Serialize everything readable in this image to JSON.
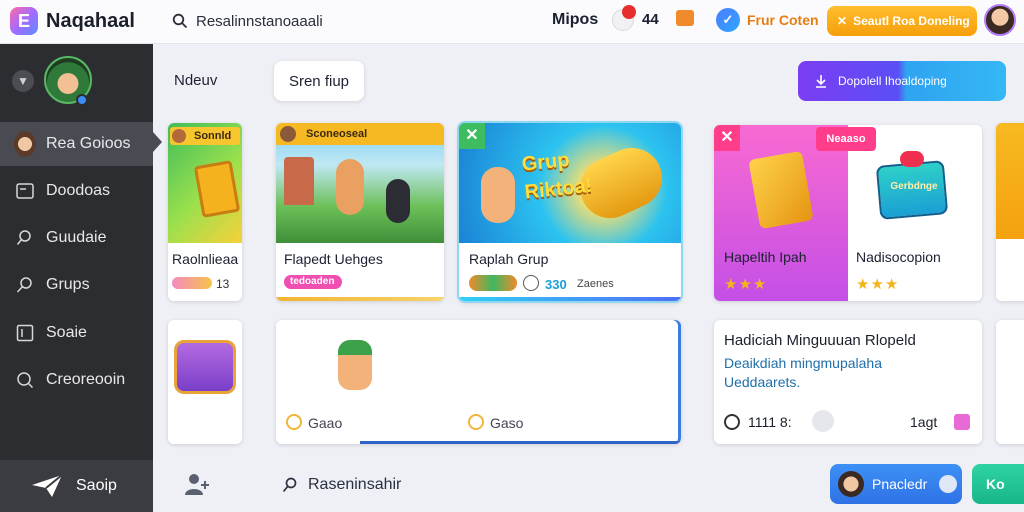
{
  "app": {
    "logo_letter": "E",
    "title": "Naqahaal"
  },
  "header": {
    "search_text": "Resalinnstanoaaali",
    "nav_label": "Mipos",
    "notif_count": "44",
    "promo_text": "Frur Coten",
    "cta_label": "Seautl Roa Doneling",
    "colors": {
      "cta": "#f5a40f",
      "promo": "#e67d12"
    }
  },
  "sidebar": {
    "section_label": "Ndeuv",
    "items": [
      {
        "label": "Rea Goioos",
        "icon": "avatar",
        "active": true
      },
      {
        "label": "Doodoas",
        "icon": "inbox-icon"
      },
      {
        "label": "Guudaie",
        "icon": "search-icon"
      },
      {
        "label": "Grups",
        "icon": "search-icon"
      },
      {
        "label": "Soaie",
        "icon": "square-icon"
      },
      {
        "label": "Creoreooin",
        "icon": "search-icon"
      }
    ],
    "bottom_label": "Saoip"
  },
  "toolbar": {
    "chip_label": "Sren fiup",
    "primary_label": "Dopolell Ihoaldoping"
  },
  "cards": {
    "c0": {
      "badge": "Sonnld",
      "title": "Raolnlieaa",
      "meta": "13"
    },
    "c1": {
      "badge": "Sconeoseal",
      "title": "Flapedt Uehges",
      "tag": "tedoaden"
    },
    "c2": {
      "overlay": "Grup Riktoa!",
      "title": "Raplah Grup",
      "meta_count": "330",
      "meta_text": "Zaenes"
    },
    "c3": {
      "badge": "Neaaso",
      "title": "Hapeltih Ipah",
      "rating": 3,
      "title2": "Nadisocopion",
      "rating2": 3,
      "art_label": "Gerbdnge"
    },
    "c4": {
      "action1": "Gaao",
      "action2": "Gaso"
    },
    "c5": {
      "heading": "Hadiciah Minguuuan Rlopeld",
      "subtext": "Deaikdiah mingmupalaha Ueddaarets.",
      "count": "1111 8:",
      "meta": "1agt"
    }
  },
  "bottom": {
    "search_text": "Raseninsahir",
    "float_label": "Pnacledr",
    "float_label2": "Ko"
  }
}
